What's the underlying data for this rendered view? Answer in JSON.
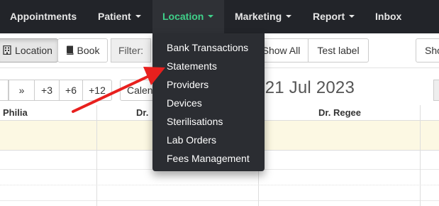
{
  "navbar": {
    "items": [
      {
        "label": "Appointments",
        "has_caret": false
      },
      {
        "label": "Patient",
        "has_caret": true
      },
      {
        "label": "Location",
        "has_caret": true,
        "active": true
      },
      {
        "label": "Marketing",
        "has_caret": true
      },
      {
        "label": "Report",
        "has_caret": true
      },
      {
        "label": "Inbox",
        "has_caret": false
      }
    ]
  },
  "location_menu": {
    "items": [
      "Bank Transactions",
      "Statements",
      "Providers",
      "Devices",
      "Sterilisations",
      "Lab Orders",
      "Fees Management"
    ]
  },
  "toolbar": {
    "location_label": "Location",
    "book_label": "Book",
    "filter_label": "Filter:",
    "show_all_label": "Show All",
    "test_label": "Test label",
    "right_partial_label": "Sho"
  },
  "date_nav": {
    "forward_label": "»",
    "plus3": "+3",
    "plus6": "+6",
    "plus12": "+12",
    "calendar_label": "Calen",
    "date_title": "ay, 21 Jul 2023"
  },
  "calendar": {
    "columns": [
      "Philia",
      "Dr.",
      "",
      "Dr. Regee"
    ]
  },
  "colors": {
    "navbar_bg": "#222429",
    "active_text": "#3fd089",
    "dropdown_bg": "#2b2d32",
    "allday_bg": "#fcf8e3",
    "arrow": "#e8201e"
  }
}
